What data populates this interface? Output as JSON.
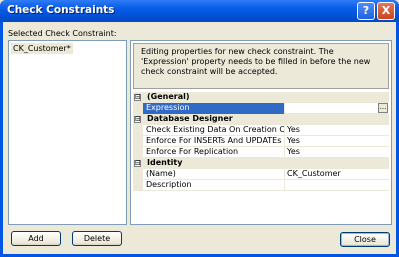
{
  "window": {
    "title": "Check Constraints",
    "help_glyph": "?",
    "close_glyph": "X"
  },
  "left_panel": {
    "label": "Selected Check Constraint:",
    "items": [
      {
        "label": "CK_Customer*",
        "selected": true
      }
    ]
  },
  "description": "Editing properties for new check constraint.  The 'Expression' property needs to be filled in before the new check constraint will be accepted.",
  "property_grid": {
    "collapse_glyph": "⊟",
    "ellipsis": "...",
    "rows": [
      {
        "type": "category",
        "label": "(General)"
      },
      {
        "type": "property",
        "name": "Expression",
        "value": "",
        "selected": true,
        "has_ellipsis": true
      },
      {
        "type": "category",
        "label": "Database Designer"
      },
      {
        "type": "property",
        "name": "Check Existing Data On Creation Or Re-E",
        "value": "Yes"
      },
      {
        "type": "property",
        "name": "Enforce For INSERTs And UPDATEs",
        "value": "Yes"
      },
      {
        "type": "property",
        "name": "Enforce For Replication",
        "value": "Yes"
      },
      {
        "type": "category",
        "label": "Identity"
      },
      {
        "type": "property",
        "name": "(Name)",
        "value": "CK_Customer"
      },
      {
        "type": "property",
        "name": "Description",
        "value": ""
      }
    ]
  },
  "buttons": {
    "add": "Add",
    "delete": "Delete",
    "close": "Close"
  }
}
